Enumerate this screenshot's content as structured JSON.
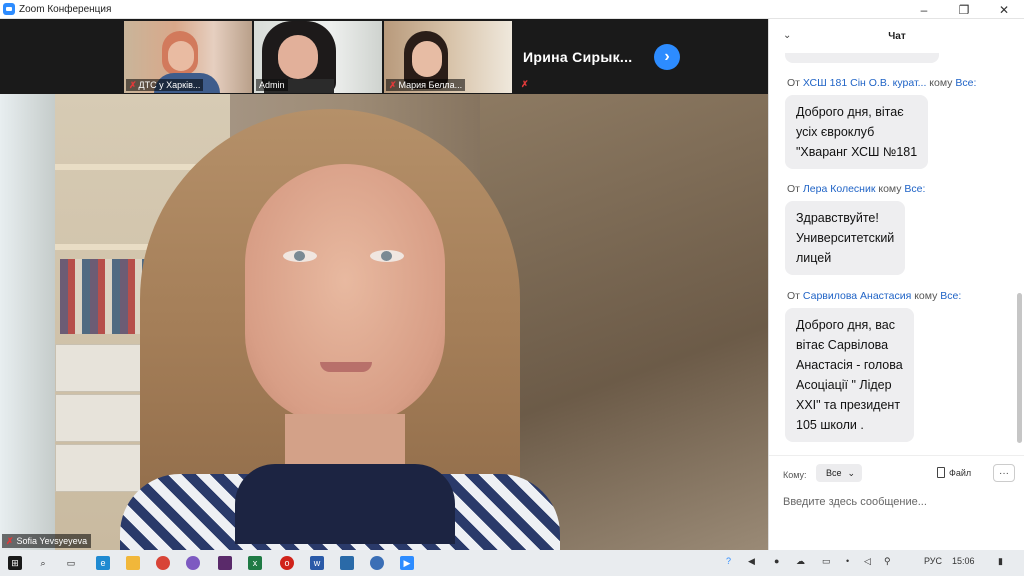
{
  "window": {
    "title": "Zoom Конференция",
    "minimize": "–",
    "maximize": "❐",
    "close": "✕"
  },
  "participants": [
    {
      "name": "ДТС у Харків..."
    },
    {
      "name": "Admin"
    },
    {
      "name": "Мария Белла..."
    }
  ],
  "name_tile": {
    "name": "Ирина  Сирык..."
  },
  "next_button": "›",
  "main_speaker": {
    "name": "Sofia Yevsyeyeva"
  },
  "chat": {
    "title": "Чат",
    "collapse": "⌄",
    "messages": [
      {
        "from": "ХСШ 181 Сін О.В. курат...",
        "to_label": "кому",
        "to": "Все:",
        "prefix": "От",
        "lines": [
          "Доброго дня, вітає",
          "усіх євроклуб",
          "\"Хваранг ХСШ №181"
        ]
      },
      {
        "from": "Лера Колесник",
        "to_label": "кому",
        "to": "Все:",
        "prefix": "От",
        "lines": [
          "Здравствуйте!",
          "Университетский",
          "лицей"
        ]
      },
      {
        "from": "Сарвилова Анастасия",
        "to_label": "кому",
        "to": "Все:",
        "prefix": "От",
        "lines": [
          "Доброго дня, вас",
          "вітає Сарвілова",
          "Анастасія - голова",
          "Асоціації \" Лідер",
          "XXI\" та президент",
          "105 школи ."
        ]
      }
    ],
    "compose": {
      "to_label": "Кому:",
      "to_value": "Все",
      "file_label": "Файл",
      "more": "···",
      "placeholder": "Введите здесь сообщение..."
    }
  },
  "taskbar": {
    "language": "РУС",
    "time": "15:06"
  },
  "colors": {
    "accent": "#2d8cff",
    "link": "#1f63c6",
    "mic_off": "#e03a3a"
  }
}
